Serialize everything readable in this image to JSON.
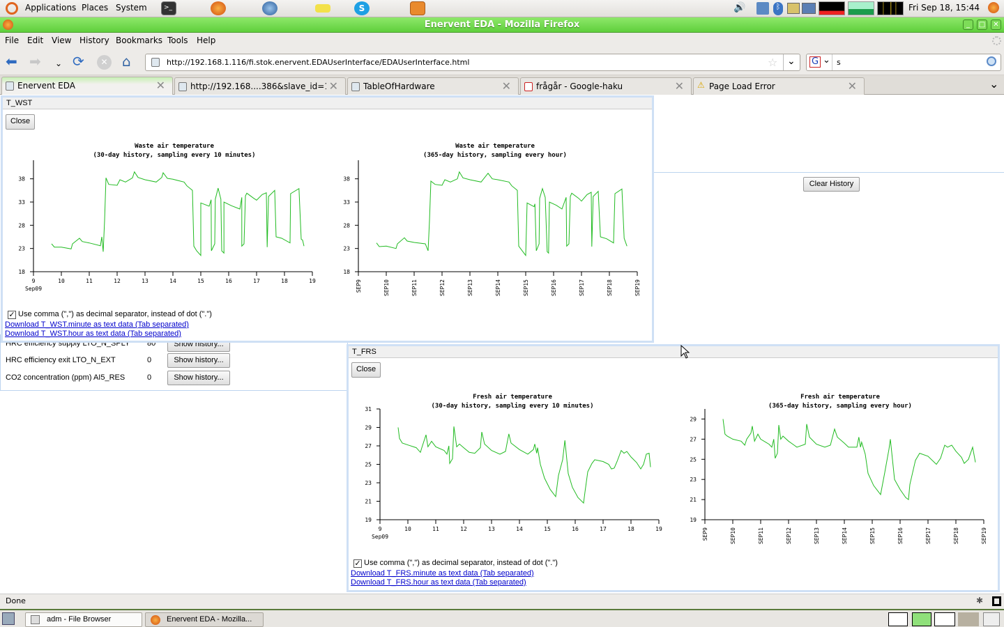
{
  "panel": {
    "menus": [
      "Applications",
      "Places",
      "System"
    ],
    "clock": "Fri Sep 18, 15:44"
  },
  "window": {
    "title": "Enervent EDA - Mozilla Firefox"
  },
  "menubar": [
    "File",
    "Edit",
    "View",
    "History",
    "Bookmarks",
    "Tools",
    "Help"
  ],
  "nav": {
    "url": "http://192.168.1.116/fi.stok.enervent.EDAUserInterface/EDAUserInterface.html",
    "search_value": "s"
  },
  "tabs": [
    {
      "label": "Enervent EDA",
      "active": true
    },
    {
      "label": "http://192.168....386&slave_id=1&"
    },
    {
      "label": "TableOfHardware"
    },
    {
      "label": "frågår - Google-haku"
    },
    {
      "label": "Page Load Error",
      "icon": "warning"
    }
  ],
  "page": {
    "clear_history": "Clear History",
    "rows": [
      {
        "label": "HRC efficiency supply LTO_N_SPLY",
        "value": "80",
        "button": "Show history..."
      },
      {
        "label": "HRC efficiency exit LTO_N_EXT",
        "value": "0",
        "button": "Show history..."
      },
      {
        "label": "CO2 concentration (ppm) AI5_RES",
        "value": "0",
        "button": "Show history..."
      }
    ]
  },
  "popups": [
    {
      "title": "T_WST",
      "close": "Close",
      "checkbox": "Use comma (\",\") as decimal separator, instead of dot (\".\")",
      "checked": true,
      "links": [
        "Download T_WST.minute as text data (Tab separated)",
        "Download T_WST.hour as text data (Tab separated)"
      ]
    },
    {
      "title": "T_FRS",
      "close": "Close",
      "checkbox": "Use comma (\",\") as decimal separator, instead of dot (\".\")",
      "checked": true,
      "links": [
        "Download T_FRS.minute as text data (Tab separated)",
        "Download T_FRS.hour as text data (Tab separated)"
      ]
    }
  ],
  "line_color": "#22bb22",
  "chart_data": [
    {
      "type": "line",
      "title": "Waste air temperature",
      "subtitle": "(30-day history, sampling every 10 minutes)",
      "xticks": [
        "9",
        "10",
        "11",
        "12",
        "13",
        "14",
        "15",
        "16",
        "17",
        "18",
        "19"
      ],
      "xsub": "Sep09",
      "xlim": [
        9,
        19
      ],
      "yticks": [
        18,
        23,
        28,
        33,
        38
      ],
      "ylim": [
        18,
        42
      ],
      "points": [
        [
          9.65,
          24
        ],
        [
          9.75,
          23.3
        ],
        [
          10.0,
          23.3
        ],
        [
          10.35,
          22.9
        ],
        [
          10.4,
          24
        ],
        [
          10.65,
          25.2
        ],
        [
          10.75,
          24.5
        ],
        [
          11.0,
          24.2
        ],
        [
          11.4,
          23.6
        ],
        [
          11.45,
          25.5
        ],
        [
          11.5,
          22.3
        ],
        [
          11.55,
          29
        ],
        [
          11.6,
          38.2
        ],
        [
          11.7,
          36.8
        ],
        [
          12.0,
          36.6
        ],
        [
          12.1,
          37.8
        ],
        [
          12.3,
          37.3
        ],
        [
          12.55,
          38.2
        ],
        [
          12.62,
          39.5
        ],
        [
          12.75,
          38.3
        ],
        [
          13.0,
          37.8
        ],
        [
          13.4,
          37.3
        ],
        [
          13.6,
          38.3
        ],
        [
          13.65,
          39.3
        ],
        [
          13.8,
          38.1
        ],
        [
          14.0,
          37.9
        ],
        [
          14.4,
          37.3
        ],
        [
          14.5,
          36.5
        ],
        [
          14.7,
          35.5
        ],
        [
          14.75,
          23.5
        ],
        [
          14.85,
          22.5
        ],
        [
          15.0,
          21.5
        ],
        [
          15.0,
          32.8
        ],
        [
          15.3,
          32.1
        ],
        [
          15.37,
          33.5
        ],
        [
          15.38,
          22.5
        ],
        [
          15.5,
          24
        ],
        [
          15.52,
          33.6
        ],
        [
          15.62,
          36
        ],
        [
          15.72,
          33.6
        ],
        [
          15.75,
          22.5
        ],
        [
          15.83,
          22
        ],
        [
          15.83,
          33
        ],
        [
          16.1,
          32.2
        ],
        [
          16.4,
          31.5
        ],
        [
          16.47,
          34
        ],
        [
          16.47,
          23.5
        ],
        [
          16.55,
          24
        ],
        [
          16.6,
          34.3
        ],
        [
          16.65,
          34.9
        ],
        [
          16.9,
          33.8
        ],
        [
          17.0,
          33.4
        ],
        [
          17.2,
          34.6
        ],
        [
          17.35,
          35.0
        ],
        [
          17.38,
          23.3
        ],
        [
          17.43,
          34.2
        ],
        [
          17.65,
          35.5
        ],
        [
          17.7,
          25.5
        ],
        [
          17.9,
          25.2
        ],
        [
          18.2,
          24.2
        ],
        [
          18.22,
          34.8
        ],
        [
          18.52,
          35.9
        ],
        [
          18.6,
          25
        ],
        [
          18.65,
          24.8
        ],
        [
          18.7,
          23.5
        ]
      ]
    },
    {
      "type": "line",
      "title": "Waste air temperature",
      "subtitle": "(365-day history, sampling every hour)",
      "xticks": [
        "SEP9",
        "SEP10",
        "SEP11",
        "SEP12",
        "SEP13",
        "SEP14",
        "SEP15",
        "SEP16",
        "SEP17",
        "SEP18",
        "SEP19"
      ],
      "xlim": [
        9,
        19
      ],
      "yticks": [
        18,
        23,
        28,
        33,
        38
      ],
      "ylim": [
        18,
        42
      ],
      "points": [
        [
          9.65,
          24.2
        ],
        [
          9.75,
          23.4
        ],
        [
          10.0,
          23.5
        ],
        [
          10.35,
          23.0
        ],
        [
          10.4,
          24
        ],
        [
          10.65,
          25.3
        ],
        [
          10.75,
          24.6
        ],
        [
          11.0,
          24.3
        ],
        [
          11.4,
          24.0
        ],
        [
          11.5,
          22.5
        ],
        [
          11.55,
          29
        ],
        [
          11.6,
          37.5
        ],
        [
          11.75,
          36.8
        ],
        [
          12.0,
          36.6
        ],
        [
          12.1,
          37.8
        ],
        [
          12.3,
          37.3
        ],
        [
          12.55,
          38.0
        ],
        [
          12.62,
          39.5
        ],
        [
          12.75,
          38.2
        ],
        [
          13.0,
          37.8
        ],
        [
          13.4,
          37.3
        ],
        [
          13.65,
          39.2
        ],
        [
          13.8,
          38.0
        ],
        [
          14.0,
          37.8
        ],
        [
          14.4,
          37.3
        ],
        [
          14.5,
          36.5
        ],
        [
          14.7,
          35.5
        ],
        [
          14.75,
          23.5
        ],
        [
          15.0,
          21.5
        ],
        [
          15.05,
          32.8
        ],
        [
          15.3,
          32.0
        ],
        [
          15.33,
          32.6
        ],
        [
          15.38,
          22.5
        ],
        [
          15.48,
          24
        ],
        [
          15.5,
          33.8
        ],
        [
          15.6,
          35.9
        ],
        [
          15.7,
          34
        ],
        [
          15.77,
          22.3
        ],
        [
          15.82,
          22
        ],
        [
          15.85,
          33
        ],
        [
          16.1,
          32.3
        ],
        [
          16.3,
          31.5
        ],
        [
          16.45,
          34
        ],
        [
          16.47,
          23.5
        ],
        [
          16.55,
          24
        ],
        [
          16.6,
          34.2
        ],
        [
          16.65,
          34.9
        ],
        [
          16.9,
          33.8
        ],
        [
          17.0,
          33.2
        ],
        [
          17.2,
          34.6
        ],
        [
          17.35,
          35.1
        ],
        [
          17.37,
          23.4
        ],
        [
          17.42,
          34.2
        ],
        [
          17.6,
          35.3
        ],
        [
          17.68,
          25.5
        ],
        [
          17.9,
          25.1
        ],
        [
          18.15,
          24.2
        ],
        [
          18.2,
          34.8
        ],
        [
          18.45,
          35.8
        ],
        [
          18.53,
          25.2
        ],
        [
          18.63,
          23.5
        ]
      ]
    },
    {
      "type": "line",
      "title": "Fresh air temperature",
      "subtitle": "(30-day history, sampling every 10 minutes)",
      "xticks": [
        "9",
        "10",
        "11",
        "12",
        "13",
        "14",
        "15",
        "16",
        "17",
        "18",
        "19"
      ],
      "xsub": "Sep09",
      "xlim": [
        9,
        19
      ],
      "yticks": [
        19,
        21,
        23,
        25,
        27,
        29,
        31
      ],
      "ylim": [
        19,
        31
      ],
      "points": [
        [
          9.65,
          29
        ],
        [
          9.7,
          27.8
        ],
        [
          9.8,
          27.3
        ],
        [
          10.0,
          27.1
        ],
        [
          10.3,
          26.8
        ],
        [
          10.45,
          26.3
        ],
        [
          10.5,
          26.8
        ],
        [
          10.65,
          28.2
        ],
        [
          10.72,
          26.9
        ],
        [
          10.85,
          27.5
        ],
        [
          11.0,
          26.9
        ],
        [
          11.3,
          26.5
        ],
        [
          11.4,
          26.1
        ],
        [
          11.47,
          27.0
        ],
        [
          11.5,
          25.1
        ],
        [
          11.6,
          25.6
        ],
        [
          11.65,
          29.1
        ],
        [
          11.75,
          26.9
        ],
        [
          11.85,
          27.2
        ],
        [
          12.0,
          26.8
        ],
        [
          12.2,
          26.3
        ],
        [
          12.4,
          26.2
        ],
        [
          12.6,
          26.8
        ],
        [
          12.65,
          28.5
        ],
        [
          12.75,
          27.2
        ],
        [
          13.0,
          26.5
        ],
        [
          13.3,
          26.1
        ],
        [
          13.5,
          26.4
        ],
        [
          13.62,
          28.3
        ],
        [
          13.7,
          27.3
        ],
        [
          14.0,
          26.6
        ],
        [
          14.3,
          26.1
        ],
        [
          14.5,
          26.6
        ],
        [
          14.55,
          27.2
        ],
        [
          14.62,
          26.2
        ],
        [
          14.65,
          26.8
        ],
        [
          14.75,
          25.0
        ],
        [
          14.9,
          23.5
        ],
        [
          15.1,
          22.3
        ],
        [
          15.3,
          21.5
        ],
        [
          15.4,
          23.8
        ],
        [
          15.55,
          25.5
        ],
        [
          15.63,
          27.6
        ],
        [
          15.75,
          24.0
        ],
        [
          15.9,
          22.5
        ],
        [
          16.1,
          21.4
        ],
        [
          16.3,
          20.8
        ],
        [
          16.35,
          22.0
        ],
        [
          16.45,
          24.2
        ],
        [
          16.6,
          25.1
        ],
        [
          16.7,
          25.5
        ],
        [
          17.0,
          25.3
        ],
        [
          17.2,
          25.0
        ],
        [
          17.3,
          24.5
        ],
        [
          17.4,
          24.6
        ],
        [
          17.5,
          25.3
        ],
        [
          17.65,
          26.5
        ],
        [
          17.75,
          26.2
        ],
        [
          17.85,
          26.4
        ],
        [
          18.0,
          25.8
        ],
        [
          18.2,
          25.2
        ],
        [
          18.35,
          24.5
        ],
        [
          18.45,
          25.0
        ],
        [
          18.55,
          26.1
        ],
        [
          18.65,
          26.2
        ],
        [
          18.7,
          24.7
        ]
      ]
    },
    {
      "type": "line",
      "title": "Fresh air temperature",
      "subtitle": "(365-day history, sampling every hour)",
      "xticks": [
        "SEP9",
        "SEP10",
        "SEP11",
        "SEP12",
        "SEP13",
        "SEP14",
        "SEP15",
        "SEP16",
        "SEP17",
        "SEP18",
        "SEP19"
      ],
      "xlim": [
        9,
        19
      ],
      "yticks": [
        19,
        21,
        23,
        25,
        27,
        29
      ],
      "ylim": [
        19,
        30
      ],
      "points": [
        [
          9.65,
          29
        ],
        [
          9.72,
          27.5
        ],
        [
          9.8,
          27.3
        ],
        [
          10.0,
          27.0
        ],
        [
          10.3,
          26.8
        ],
        [
          10.43,
          26.4
        ],
        [
          10.5,
          27.0
        ],
        [
          10.65,
          27.6
        ],
        [
          10.7,
          28.3
        ],
        [
          10.78,
          26.8
        ],
        [
          10.9,
          27.5
        ],
        [
          11.0,
          27.0
        ],
        [
          11.3,
          26.5
        ],
        [
          11.4,
          26.2
        ],
        [
          11.47,
          27.0
        ],
        [
          11.52,
          25.1
        ],
        [
          11.6,
          25.6
        ],
        [
          11.65,
          28.4
        ],
        [
          11.72,
          27.0
        ],
        [
          11.8,
          27.3
        ],
        [
          12.0,
          26.8
        ],
        [
          12.2,
          26.4
        ],
        [
          12.3,
          26.2
        ],
        [
          12.6,
          26.5
        ],
        [
          12.65,
          28.5
        ],
        [
          12.75,
          27.2
        ],
        [
          13.0,
          26.5
        ],
        [
          13.3,
          26.2
        ],
        [
          13.5,
          26.4
        ],
        [
          13.65,
          28.0
        ],
        [
          13.75,
          27.2
        ],
        [
          14.0,
          26.6
        ],
        [
          14.15,
          26.2
        ],
        [
          14.45,
          26.2
        ],
        [
          14.52,
          27.2
        ],
        [
          14.58,
          26.2
        ],
        [
          14.62,
          26.7
        ],
        [
          14.75,
          25.5
        ],
        [
          14.85,
          23.6
        ],
        [
          15.05,
          22.4
        ],
        [
          15.3,
          21.5
        ],
        [
          15.45,
          23.7
        ],
        [
          15.6,
          26.0
        ],
        [
          15.65,
          27.0
        ],
        [
          15.8,
          23.0
        ],
        [
          16.0,
          22.0
        ],
        [
          16.2,
          21.2
        ],
        [
          16.3,
          21.0
        ],
        [
          16.35,
          22.5
        ],
        [
          16.55,
          24.9
        ],
        [
          16.7,
          25.6
        ],
        [
          17.0,
          25.3
        ],
        [
          17.3,
          24.5
        ],
        [
          17.45,
          25.1
        ],
        [
          17.6,
          26.4
        ],
        [
          17.7,
          26.2
        ],
        [
          17.85,
          26.4
        ],
        [
          18.0,
          25.8
        ],
        [
          18.2,
          25.2
        ],
        [
          18.3,
          24.6
        ],
        [
          18.45,
          25.0
        ],
        [
          18.6,
          26.2
        ],
        [
          18.7,
          24.7
        ]
      ]
    }
  ]
}
